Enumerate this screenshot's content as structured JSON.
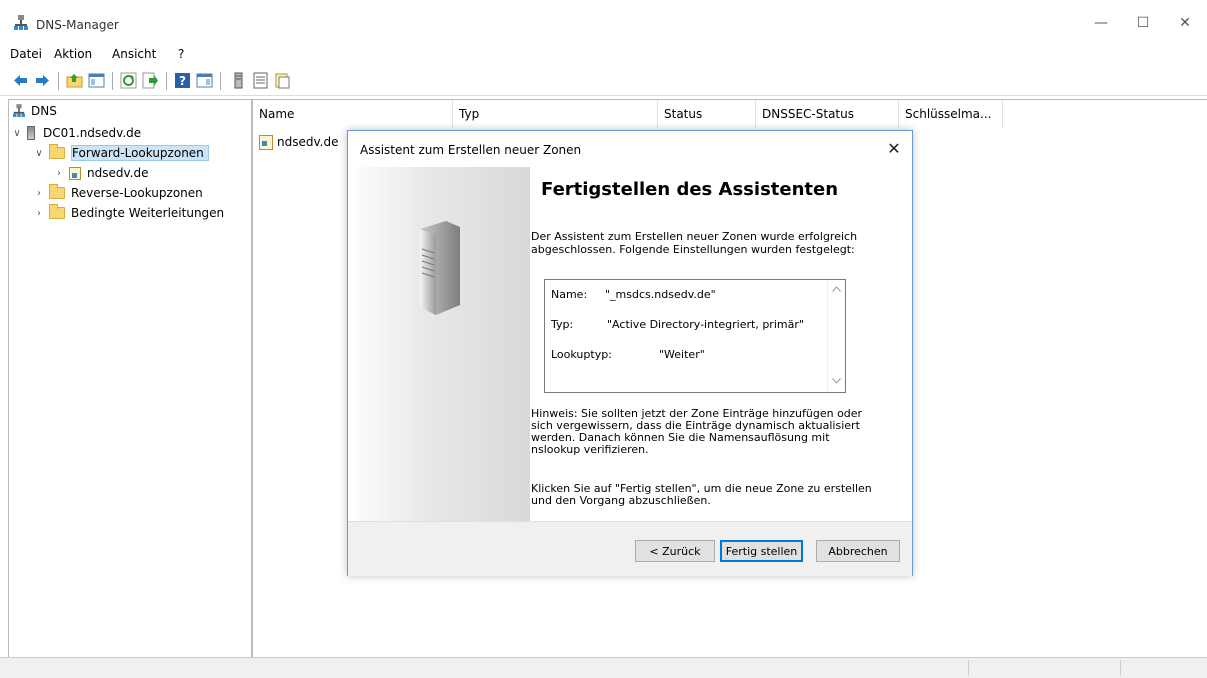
{
  "window": {
    "title": "DNS-Manager",
    "minimize_label": "—",
    "maximize_label": "☐",
    "close_label": "✕"
  },
  "menu": {
    "items": [
      "Datei",
      "Aktion",
      "Ansicht",
      "?"
    ]
  },
  "toolbar": {
    "icons": [
      "back-arrow-icon",
      "forward-arrow-icon",
      "up-folder-icon",
      "show-hide-tree-icon",
      "refresh-icon",
      "export-list-icon",
      "help-icon",
      "action-pane-icon",
      "server-icon",
      "list-icon",
      "properties-icon"
    ]
  },
  "tree": {
    "root": "DNS",
    "server": "DC01.ndsedv.de",
    "forward_zones": "Forward-Lookupzonen",
    "zone_child": "ndsedv.de",
    "reverse_zones": "Reverse-Lookupzonen",
    "conditional_forwarders": "Bedingte Weiterleitungen",
    "expanded_glyph": "∨",
    "collapsed_glyph": "›"
  },
  "list": {
    "columns": [
      "Name",
      "Typ",
      "Status",
      "DNSSEC-Status",
      "Schlüsselma..."
    ],
    "rows": [
      {
        "name": "ndsedv.de"
      }
    ]
  },
  "dialog": {
    "title": "Assistent zum Erstellen neuer Zonen",
    "close_label": "✕",
    "heading": "Fertigstellen des Assistenten",
    "intro": "Der Assistent zum Erstellen neuer Zonen wurde erfolgreich abgeschlossen. Folgende Einstellungen wurden festgelegt:",
    "summary": {
      "name_label": "Name:",
      "name_value": "\"_msdcs.ndsedv.de\"",
      "type_label": "Typ:",
      "type_value": "\"Active Directory-integriert, primär\"",
      "lookup_label": "Lookuptyp:",
      "lookup_value": "\"Weiter\""
    },
    "note": "Hinweis: Sie sollten jetzt der Zone Einträge hinzufügen oder sich vergewissern, dass die Einträge dynamisch aktualisiert werden. Danach können Sie die Namensauflösung mit nslookup verifizieren.",
    "finish_note": "Klicken Sie auf \"Fertig stellen\", um die neue Zone zu erstellen und den Vorgang abzuschließen.",
    "buttons": {
      "back": "< Zurück",
      "finish": "Fertig stellen",
      "cancel": "Abbrechen"
    }
  },
  "colors": {
    "accent": "#0078d7",
    "selection": "#cce4f7",
    "folder": "#f7d774"
  }
}
